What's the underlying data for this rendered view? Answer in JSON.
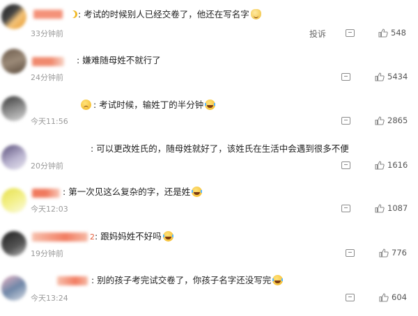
{
  "report_label": "投诉",
  "comments": [
    {
      "text": "考试的时候别人已经交卷了，他还在写名字",
      "time": "33分钟前",
      "likes": "548",
      "emoji": "cat"
    },
    {
      "text": "嫌难随母姓不就行了",
      "time": "24分钟前",
      "likes": "5434",
      "emoji": ""
    },
    {
      "text": "考试时候，输姓丁的半分钟",
      "time": "今天11:56",
      "likes": "2865",
      "emoji": "laugh"
    },
    {
      "text": "可以更改姓氏的，随母姓就好了，该姓氏在生活中会遇到很多不便",
      "time": "20分钟前",
      "likes": "1616",
      "emoji": ""
    },
    {
      "text": "第一次见这么复杂的字，还是姓",
      "time": "今天12:03",
      "likes": "1087",
      "emoji": "laugh"
    },
    {
      "text": "跟妈妈姓不好吗",
      "time": "19分钟前",
      "likes": "776",
      "emoji": "laugh"
    },
    {
      "text": "别的孩子考完试交卷了，你孩子名字还没写完",
      "time": "今天13:24",
      "likes": "604",
      "emoji": "laugh"
    }
  ],
  "colors": {
    "name_blur": "#f4a08a",
    "time": "#9a9a9a",
    "icon": "#8a8a8a"
  }
}
